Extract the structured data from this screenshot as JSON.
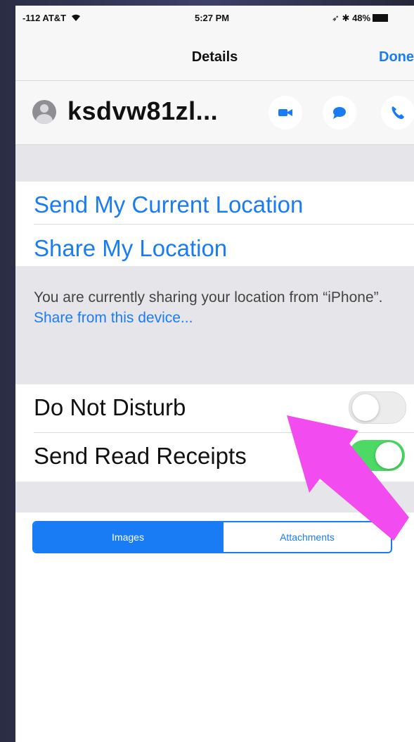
{
  "status_bar": {
    "carrier": "-112 AT&T",
    "time": "5:27 PM",
    "battery": "48%"
  },
  "nav": {
    "title": "Details",
    "done_label": "Done"
  },
  "contact": {
    "name": "ksdvw81zl..."
  },
  "location": {
    "send_current": "Send My Current Location",
    "share": "Share My Location",
    "note_text": "You are currently sharing your location from “iPhone”.",
    "note_link": "Share from this device..."
  },
  "settings": {
    "do_not_disturb": {
      "label": "Do Not Disturb",
      "on": false
    },
    "read_receipts": {
      "label": "Send Read Receipts",
      "on": true
    }
  },
  "segments": {
    "images": "Images",
    "attachments": "Attachments",
    "selected": "Images"
  },
  "colors": {
    "accent": "#1a7cf5",
    "toggle_on": "#4cd964",
    "annotation_arrow": "#f24bf0"
  }
}
